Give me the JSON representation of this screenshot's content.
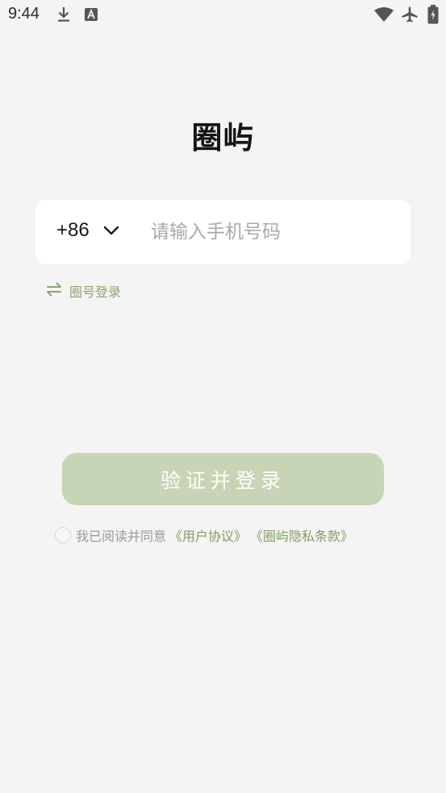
{
  "status_bar": {
    "time": "9:44",
    "icons": [
      "download-icon",
      "font-a-icon",
      "wifi-icon",
      "airplane-icon",
      "battery-icon"
    ]
  },
  "app": {
    "title": "圈屿"
  },
  "phone_form": {
    "country_code": "+86",
    "placeholder": "请输入手机号码",
    "value": ""
  },
  "switch_login": {
    "label": "圈号登录"
  },
  "submit": {
    "label": "验证并登录"
  },
  "agreement": {
    "checked": false,
    "prefix": "我已阅读并同意",
    "user_agreement": "《用户协议》",
    "privacy_policy": "《圈屿隐私条款》"
  },
  "colors": {
    "background": "#f4f4f4",
    "accent": "#8aa56f",
    "button_disabled": "#c7d4b5",
    "card": "#ffffff"
  }
}
